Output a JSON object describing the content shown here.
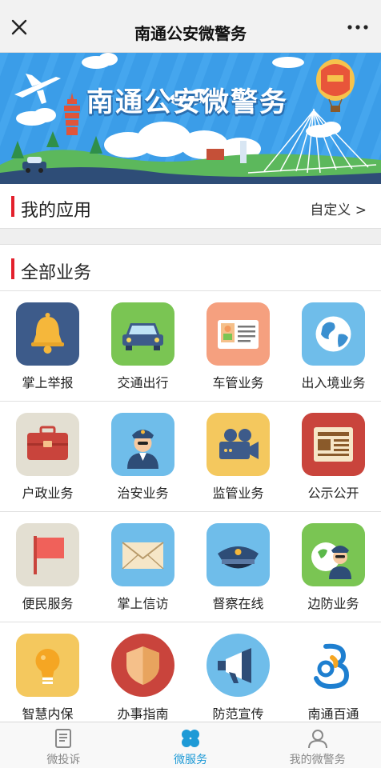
{
  "header": {
    "title": "南通公安微警务",
    "close_icon": "close-icon",
    "more_icon": "more-dots-icon"
  },
  "banner": {
    "title": "南通公安微警务"
  },
  "my_apps": {
    "label": "我的应用",
    "customize": "自定义 >"
  },
  "all_business": {
    "label": "全部业务"
  },
  "services": [
    {
      "label": "掌上举报",
      "icon": "bell-icon",
      "bg": "#3d5b8a"
    },
    {
      "label": "交通出行",
      "icon": "car-icon",
      "bg": "#7ac553"
    },
    {
      "label": "车管业务",
      "icon": "id-card-icon",
      "bg": "#f5a07f"
    },
    {
      "label": "出入境业务",
      "icon": "globe-icon",
      "bg": "#4aa8e4"
    },
    {
      "label": "户政业务",
      "icon": "briefcase-icon",
      "bg": "#e3dfd2"
    },
    {
      "label": "治安业务",
      "icon": "police-officer-icon",
      "bg": "#6fbdea"
    },
    {
      "label": "监管业务",
      "icon": "camera-icon",
      "bg": "#f4c85e"
    },
    {
      "label": "公示公开",
      "icon": "newspaper-icon",
      "bg": "#c9443c"
    },
    {
      "label": "便民服务",
      "icon": "flag-icon",
      "bg": "#e3dfd2"
    },
    {
      "label": "掌上信访",
      "icon": "envelope-icon",
      "bg": "#6fbdea"
    },
    {
      "label": "督察在线",
      "icon": "police-cap-icon",
      "bg": "#6fbdea"
    },
    {
      "label": "边防业务",
      "icon": "border-police-icon",
      "bg": "#7ac553"
    },
    {
      "label": "智慧内保",
      "icon": "lightbulb-icon",
      "bg": "#f4c85e"
    },
    {
      "label": "办事指南",
      "icon": "shield-icon",
      "bg": "#c9443c"
    },
    {
      "label": "防范宣传",
      "icon": "megaphone-icon",
      "bg": "#6fbdea"
    },
    {
      "label": "南通百通",
      "icon": "nantong-logo-icon",
      "bg": "#ffffff"
    }
  ],
  "bottom_nav": [
    {
      "label": "微投诉",
      "icon": "document-icon",
      "active": false
    },
    {
      "label": "微服务",
      "icon": "clover-icon",
      "active": true
    },
    {
      "label": "我的微警务",
      "icon": "user-icon",
      "active": false
    }
  ],
  "colors": {
    "accent_red": "#e3202c",
    "active_blue": "#1e9ad6"
  }
}
